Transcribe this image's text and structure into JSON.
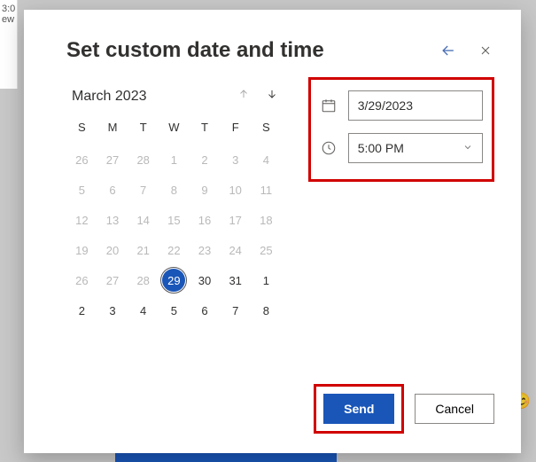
{
  "background": {
    "time_fragment": "3:0",
    "text_fragment": "ew"
  },
  "modal": {
    "title": "Set custom date and time"
  },
  "calendar": {
    "month_label": "March 2023",
    "dow": [
      "S",
      "M",
      "T",
      "W",
      "T",
      "F",
      "S"
    ],
    "prev_trailing": [
      "26",
      "27",
      "28",
      "1",
      "2",
      "3",
      "4"
    ],
    "rows_muted": [
      [
        "5",
        "6",
        "7",
        "8",
        "9",
        "10",
        "11"
      ],
      [
        "12",
        "13",
        "14",
        "15",
        "16",
        "17",
        "18"
      ],
      [
        "19",
        "20",
        "21",
        "22",
        "23",
        "24",
        "25"
      ]
    ],
    "row_mixed": [
      "26",
      "27",
      "28",
      "29",
      "30",
      "31",
      "1"
    ],
    "selected_index": 3,
    "next_trailing": [
      "2",
      "3",
      "4",
      "5",
      "6",
      "7",
      "8"
    ]
  },
  "datetime": {
    "date_value": "3/29/2023",
    "time_value": "5:00 PM"
  },
  "footer": {
    "send": "Send",
    "cancel": "Cancel"
  }
}
